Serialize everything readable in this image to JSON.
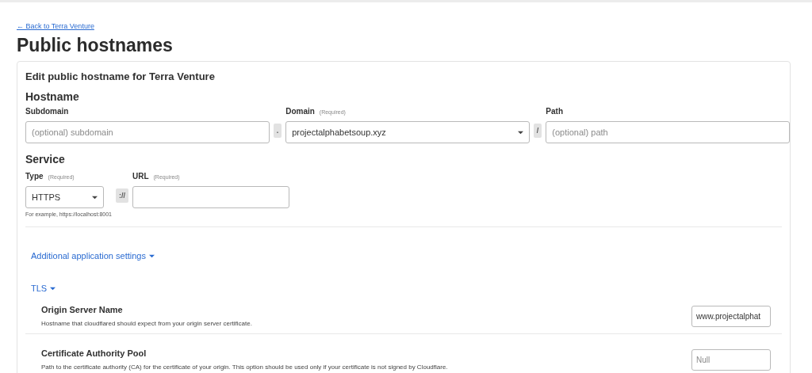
{
  "back_link": "← Back to Terra Venture",
  "title": "Public hostnames",
  "form": {
    "heading": "Edit public hostname for Terra Venture",
    "hostname": {
      "title": "Hostname",
      "fields": [
        {
          "kind": "input",
          "label": "Subdomain",
          "placeholder": "(optional) subdomain"
        },
        {
          "kind": "separator",
          "text": "."
        },
        {
          "kind": "select",
          "label": "Domain",
          "required": "(Required)",
          "value": "projectalphabetsoup.xyz"
        },
        {
          "kind": "separator",
          "text": "/"
        },
        {
          "kind": "input",
          "label": "Path",
          "placeholder": "(optional) path"
        }
      ]
    },
    "service": {
      "title": "Service",
      "fields": [
        {
          "kind": "select",
          "label": "Type",
          "required": "(Required)",
          "value": "HTTPS",
          "hint": "For example, https://localhost:8001"
        },
        {
          "kind": "separator",
          "text": "://"
        },
        {
          "kind": "input",
          "label": "URL",
          "required": "(Required)"
        }
      ]
    },
    "additional_settings": {
      "label": "Additional application settings",
      "expanded": true
    },
    "tls": {
      "label": "TLS",
      "expanded": true,
      "settings": [
        {
          "title": "Origin Server Name",
          "description": "Hostname that cloudflared should expect from your origin server certificate.",
          "value": "www.projectalphat"
        },
        {
          "title": "Certificate Authority Pool",
          "description": "Path to the certificate authority (CA) for the certificate of your origin. This option should be used only if your certificate is not signed by Cloudflare.",
          "placeholder": "Null"
        }
      ]
    }
  }
}
